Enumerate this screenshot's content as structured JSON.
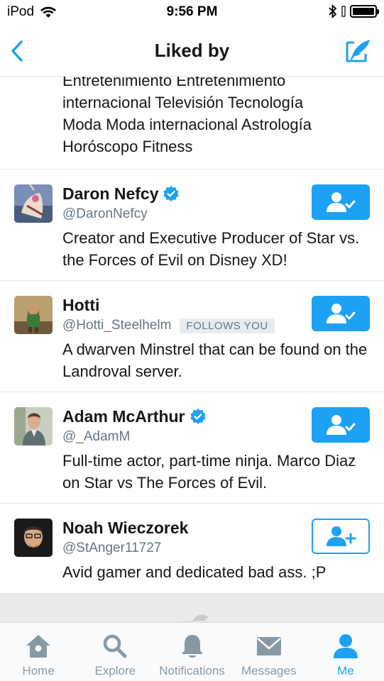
{
  "status_bar": {
    "carrier": "iPod",
    "time": "9:56 PM"
  },
  "nav": {
    "title": "Liked by",
    "back_icon": "chevron-left-icon",
    "compose_icon": "compose-tweet-icon"
  },
  "list": {
    "partial_bio_lines": [
      "Entretenimiento Entretenimiento",
      "internacional Televisión Tecnología",
      "Moda Moda internacional Astrología",
      "Horóscopo Fitness"
    ],
    "users": [
      {
        "name": "Daron Nefcy",
        "handle": "@DaronNefcy",
        "verified": true,
        "follows_you": "",
        "bio": "Creator and Executive Producer of Star vs. the Forces of Evil on Disney XD!",
        "following": true
      },
      {
        "name": "Hotti",
        "handle": "@Hotti_Steelhelm",
        "verified": false,
        "follows_you": "FOLLOWS YOU",
        "bio": "A dwarven Minstrel that can be found on the Landroval server.",
        "following": true
      },
      {
        "name": "Adam McArthur",
        "handle": "@_AdamM",
        "verified": true,
        "follows_you": "",
        "bio": "Full-time actor, part-time ninja. Marco Diaz on Star vs The Forces of Evil.",
        "following": true
      },
      {
        "name": "Noah Wieczorek",
        "handle": "@StAnger11727",
        "verified": false,
        "follows_you": "",
        "bio": "Avid gamer and dedicated bad ass. ;P",
        "following": false
      }
    ]
  },
  "tabs": [
    {
      "label": "Home",
      "icon": "home-icon",
      "active": false
    },
    {
      "label": "Explore",
      "icon": "search-icon",
      "active": false
    },
    {
      "label": "Notifications",
      "icon": "bell-icon",
      "active": false
    },
    {
      "label": "Messages",
      "icon": "envelope-icon",
      "active": false
    },
    {
      "label": "Me",
      "icon": "person-icon",
      "active": true
    }
  ],
  "colors": {
    "accent": "#1da1f2",
    "tab_inactive": "#8899a6",
    "text": "#14171a",
    "secondary_text": "#657786"
  }
}
